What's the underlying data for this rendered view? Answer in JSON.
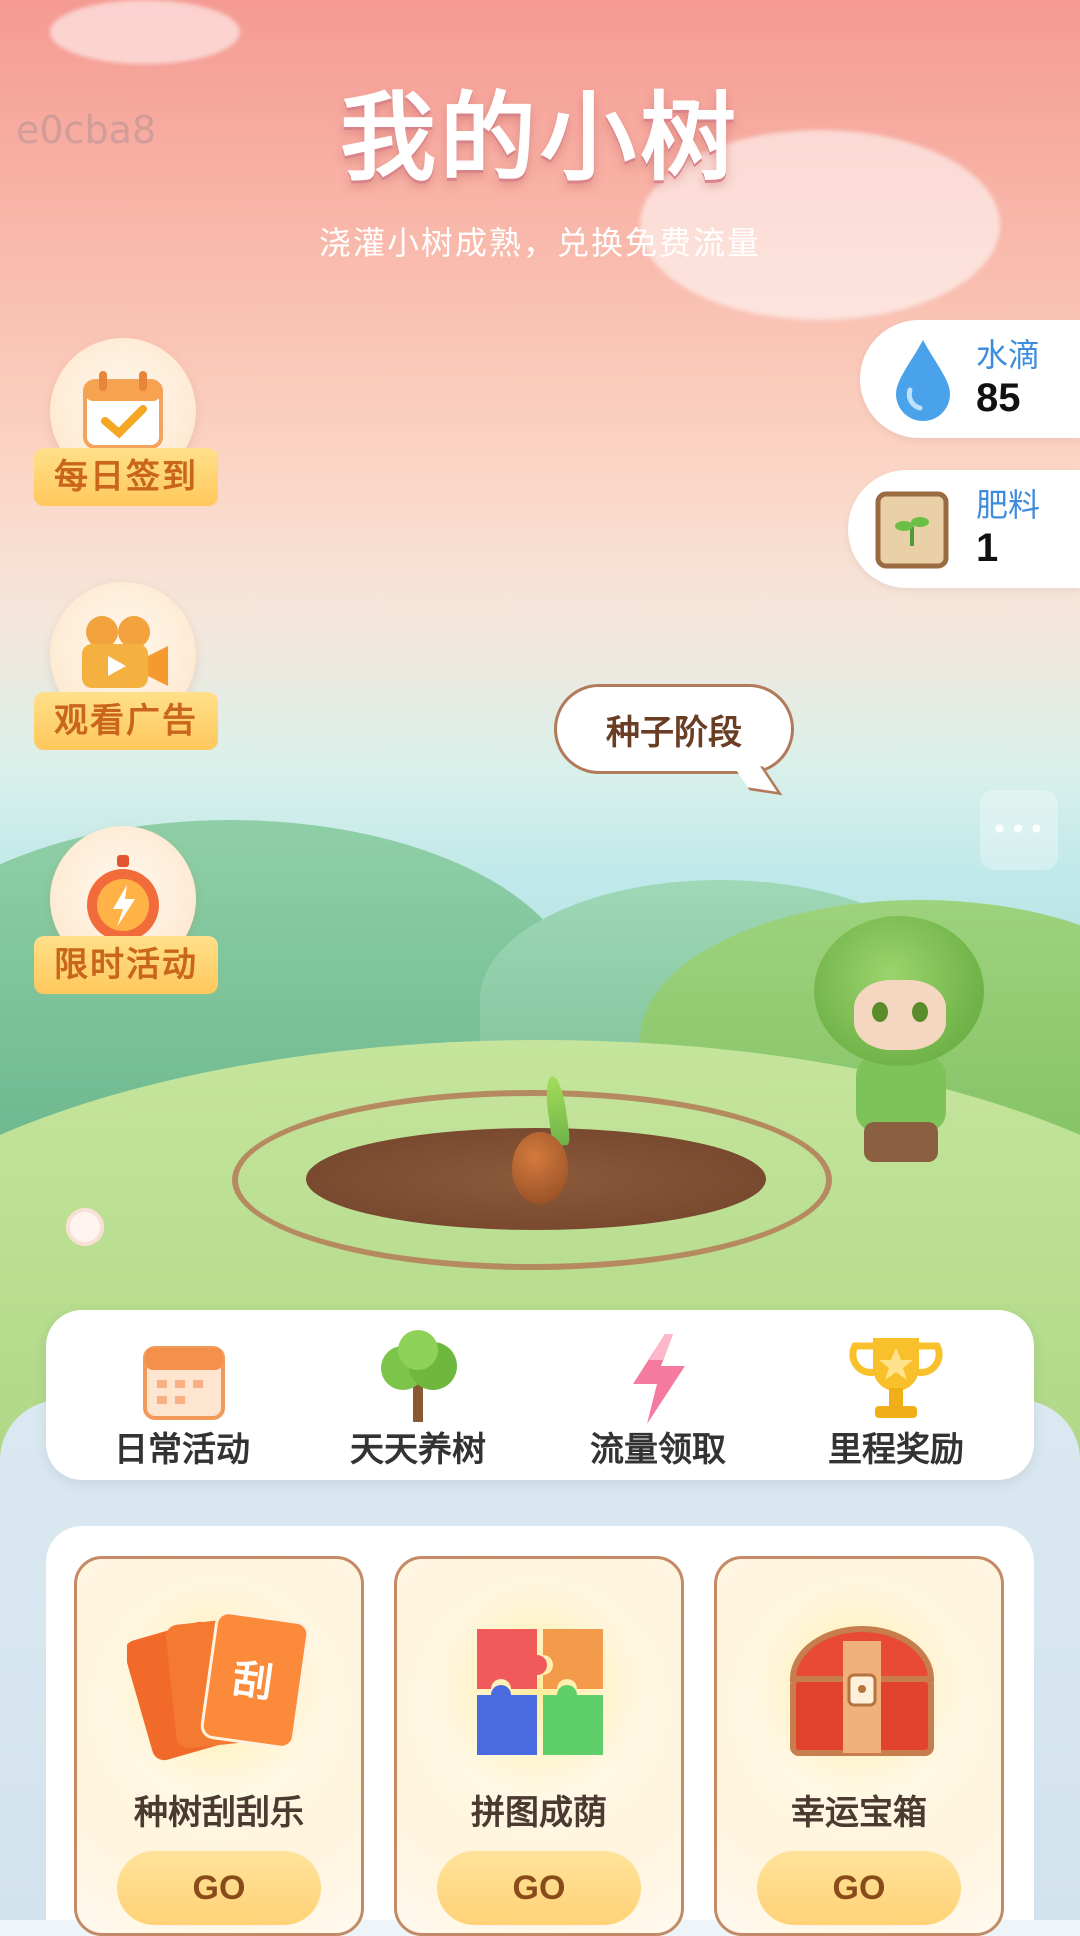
{
  "watermark": "e0cba8",
  "header": {
    "title": "我的小树",
    "subtitle": "浇灌小树成熟，兑换免费流量"
  },
  "side_buttons": [
    {
      "label": "每日签到",
      "icon": "calendar-check-icon"
    },
    {
      "label": "观看广告",
      "icon": "video-camera-icon"
    },
    {
      "label": "限时活动",
      "icon": "stopwatch-icon"
    }
  ],
  "resources": {
    "water": {
      "label": "水滴",
      "value": "85",
      "icon": "water-drop-icon"
    },
    "fertilizer": {
      "label": "肥料",
      "value": "1",
      "icon": "fertilizer-bag-icon"
    }
  },
  "stage_bubble": "种子阶段",
  "more_tab": "•••",
  "tabs": [
    {
      "label": "日常活动",
      "icon": "calendar-icon"
    },
    {
      "label": "天天养树",
      "icon": "tree-icon"
    },
    {
      "label": "流量领取",
      "icon": "lightning-icon"
    },
    {
      "label": "里程奖励",
      "icon": "trophy-icon"
    }
  ],
  "games": [
    {
      "title": "种树刮刮乐",
      "button": "GO",
      "icon": "scratch-card-icon",
      "card_text": "刮"
    },
    {
      "title": "拼图成荫",
      "button": "GO",
      "icon": "puzzle-icon"
    },
    {
      "title": "幸运宝箱",
      "button": "GO",
      "icon": "treasure-chest-icon"
    }
  ],
  "colors": {
    "accent_orange": "#c9661c",
    "water_blue": "#3e8ddc",
    "label_yellow": "#ffc85c"
  }
}
